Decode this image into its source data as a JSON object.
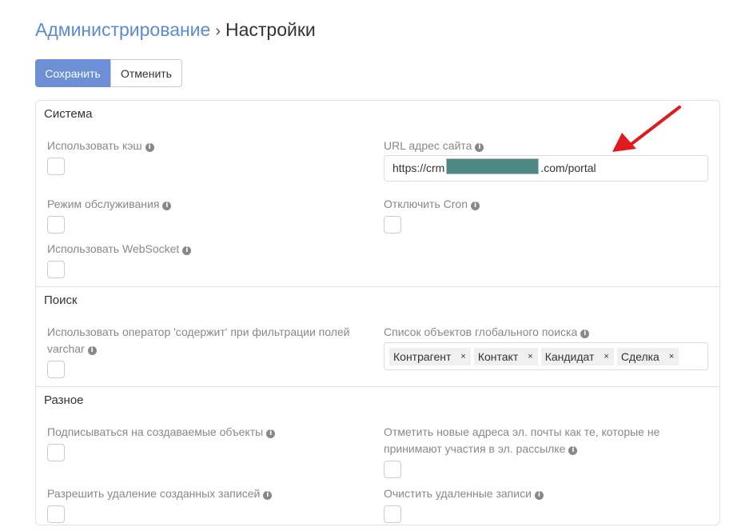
{
  "header": {
    "breadcrumb": "Администрирование",
    "separator": "›",
    "title": "Настройки"
  },
  "toolbar": {
    "save_label": "Сохранить",
    "cancel_label": "Отменить"
  },
  "sections": {
    "system": {
      "title": "Система",
      "use_cache": "Использовать кэш",
      "site_url_label": "URL адрес сайта",
      "site_url_prefix": "https://crm",
      "site_url_suffix": ".com/portal",
      "maintenance_mode": "Режим обслуживания",
      "disable_cron": "Отключить Cron",
      "use_websocket": "Использовать WebSocket"
    },
    "search": {
      "title": "Поиск",
      "contains_operator": "Использовать оператор 'содержит' при фильтрации полей varchar",
      "global_search_list": "Список объектов глобального поиска",
      "global_search_tags": [
        "Контрагент",
        "Контакт",
        "Кандидат",
        "Сделка"
      ]
    },
    "misc": {
      "title": "Разное",
      "subscribe_created": "Подписываться на создаваемые объекты",
      "mark_emails_opted_out": "Отметить новые адреса эл. почты как те, которые не принимают участия в эл. рассылке",
      "allow_delete_created": "Разрешить удаление созданных записей",
      "clean_deleted": "Очистить удаленные записи"
    }
  },
  "icons": {
    "info": "info-icon",
    "remove": "×"
  },
  "colors": {
    "primary": "#6c8fd6",
    "breadcrumb": "#5b8bd0",
    "annotation_arrow": "#e01b1b"
  }
}
